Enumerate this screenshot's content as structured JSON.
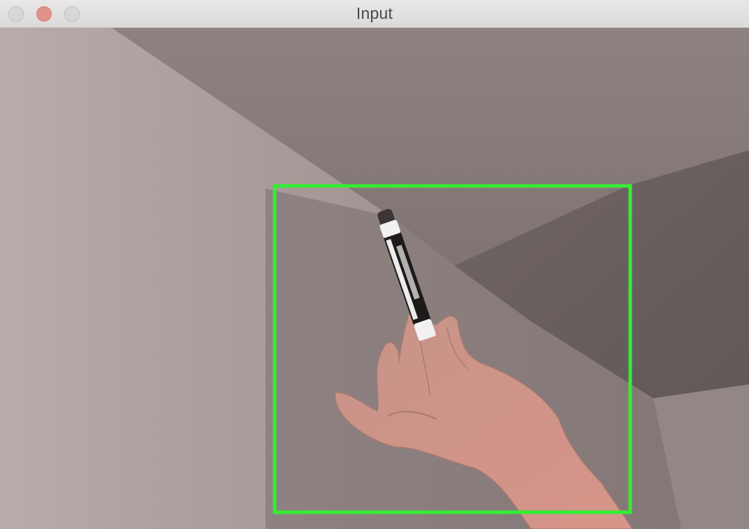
{
  "window": {
    "title": "Input",
    "controls": [
      "close-button",
      "minimize-button",
      "zoom-button"
    ]
  },
  "detection_box": {
    "color": "#33ee33",
    "label": ""
  },
  "scene": {
    "object": "marker-pen-icon",
    "hand": "hand-icon"
  }
}
